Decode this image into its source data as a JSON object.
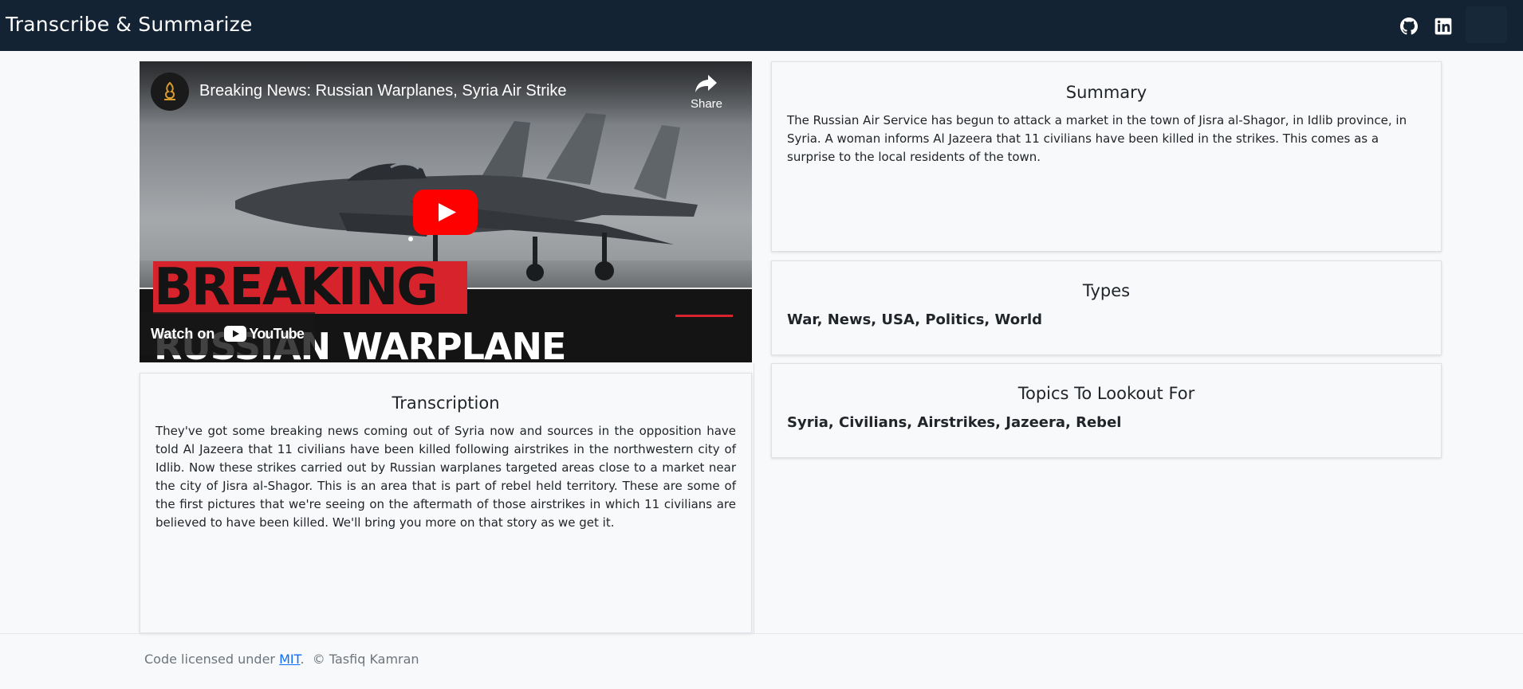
{
  "app": {
    "brand": "Transcribe & Summarize",
    "nav_icons": [
      "github-icon",
      "linkedin-icon"
    ]
  },
  "video": {
    "title": "Breaking News: Russian Warplanes, Syria Air Strike",
    "share_label": "Share",
    "watch_on_label": "Watch on",
    "youtube_label": "YouTube",
    "overlay_breaking": "BREAKING",
    "overlay_headline": "RUSSIAN WARPLANE"
  },
  "summary": {
    "title": "Summary",
    "text": "The Russian Air Service has begun to attack a market in the town of Jisra al-Shagor, in Idlib province, in Syria. A woman informs Al Jazeera that 11 civilians have been killed in the strikes. This comes as a surprise to the local residents of the town."
  },
  "types": {
    "title": "Types",
    "items": "War, News, USA, Politics, World"
  },
  "topics": {
    "title": "Topics To Lookout For",
    "items": "Syria, Civilians, Airstrikes, Jazeera, Rebel"
  },
  "transcription": {
    "title": "Transcription",
    "text": "They've got some breaking news coming out of Syria now and sources in the opposition have told Al Jazeera that 11 civilians have been killed following airstrikes in the northwestern city of Idlib. Now these strikes carried out by Russian warplanes targeted areas close to a market near the city of Jisra al-Shagor. This is an area that is part of rebel held territory. These are some of the first pictures that we're seeing on the aftermath of those airstrikes in which 11 civilians are believed to have been killed. We'll bring you more on that story as we get it."
  },
  "footer": {
    "prefix": "Code licensed under",
    "license_link": "MIT",
    "period": ".",
    "copyright": "© Tasfiq Kamran"
  },
  "colors": {
    "navbar": "#132333",
    "youtube_red": "#ff0000",
    "breaking_red": "#d7232c",
    "link": "#0d6efd"
  }
}
